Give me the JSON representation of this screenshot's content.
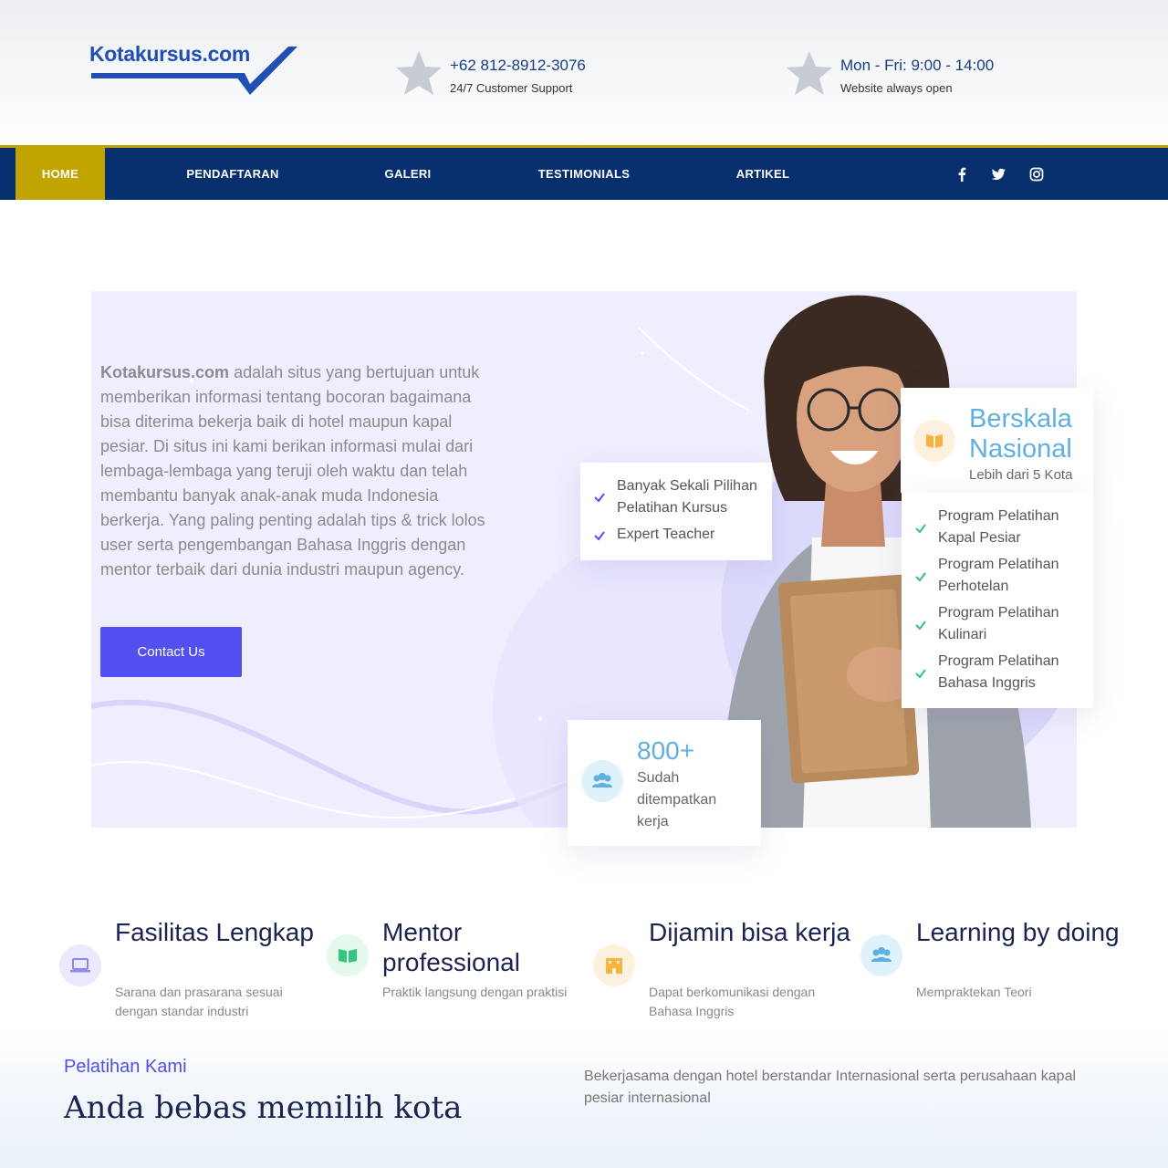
{
  "brand": {
    "logo_text": "Kotakursus.com",
    "accent": "#c2a400",
    "nav_bg": "#072f6e",
    "primary": "#5350f2"
  },
  "header": {
    "phone": {
      "title": "+62 812-8912-3076",
      "sub": "24/7 Customer Support",
      "icon": "star-icon"
    },
    "hours": {
      "title": "Mon - Fri: 9:00 - 14:00",
      "sub": "Website always open",
      "icon": "star-icon"
    }
  },
  "nav": {
    "items": [
      {
        "label": "HOME",
        "active": true
      },
      {
        "label": "PENDAFTARAN"
      },
      {
        "label": "GALERI"
      },
      {
        "label": "TESTIMONIALS"
      },
      {
        "label": "ARTIKEL"
      }
    ],
    "social": [
      "facebook-icon",
      "twitter-icon",
      "instagram-icon"
    ]
  },
  "hero": {
    "brand_bold": "Kotakursus.com",
    "description": "adalah situs yang bertujuan untuk memberikan informasi tentang bocoran bagaimana bisa diterima  bekerja baik di hotel maupun kapal pesiar. Di situs ini kami berikan informasi mulai dari lembaga-lembaga yang teruji oleh waktu dan telah membantu banyak anak-anak muda Indonesia berkerja. Yang paling penting adalah tips & trick lolos user serta pengembangan Bahasa Inggris dengan mentor terbaik dari dunia industri maupun agency.",
    "cta": "Contact Us",
    "card_list": [
      "Banyak Sekali Pilihan Pelatihan Kursus",
      "Expert Teacher"
    ],
    "nasional": {
      "title": "Berskala Nasional",
      "sub": "Lebih dari 5 Kota",
      "icon": "book-icon"
    },
    "programs": [
      "Program Pelatihan Kapal Pesiar",
      "Program Pelatihan Perhotelan",
      "Program Pelatihan Kulinari",
      "Program Pelatihan Bahasa Inggris"
    ],
    "placed": {
      "count": "800+",
      "sub": "Sudah ditempatkan kerja",
      "icon": "users-icon"
    }
  },
  "features": [
    {
      "title": "Fasilitas Lengkap",
      "desc": "Sarana dan prasarana sesuai dengan standar industri",
      "icon": "laptop-icon",
      "color": "#ebe9fd"
    },
    {
      "title": "Mentor professional",
      "desc": "Praktik langsung dengan praktisi",
      "icon": "book-icon",
      "color": "#e4f8ec"
    },
    {
      "title": "Dijamin bisa kerja",
      "desc": "Dapat berkomunikasi dengan Bahasa Inggris",
      "icon": "building-icon",
      "color": "#fdf1de"
    },
    {
      "title": "Learning by doing",
      "desc": "Mempraktekan Teori",
      "icon": "users-icon",
      "color": "#dff2fb"
    }
  ],
  "section": {
    "kicker": "Pelatihan Kami",
    "headline": "Anda bebas memilih kota",
    "desc": "Bekerjasama dengan hotel berstandar Internasional serta perusahaan kapal pesiar internasional"
  }
}
